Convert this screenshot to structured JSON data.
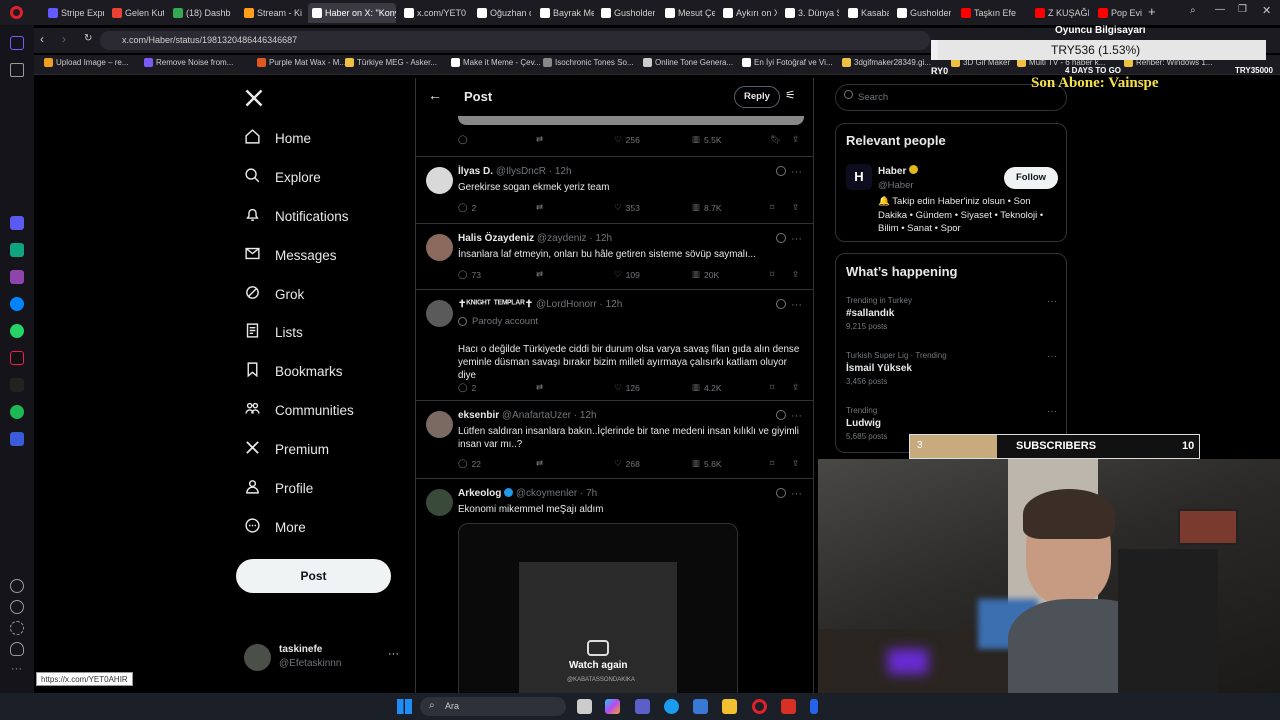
{
  "browser": {
    "tabs": [
      {
        "label": "Stripe Expre",
        "color": "#635bff"
      },
      {
        "label": "Gelen Kutu",
        "color": "#ea4335"
      },
      {
        "label": "(18) Dashb",
        "color": "#34a853"
      },
      {
        "label": "Stream - Ki",
        "color": "#ff9f1a"
      },
      {
        "label": "Haber on X: \"Konya",
        "color": "#ffffff"
      },
      {
        "label": "x.com/YET0",
        "color": "#ffffff"
      },
      {
        "label": "Oğuzhan on",
        "color": "#ffffff"
      },
      {
        "label": "Bayrak Med",
        "color": "#ffffff"
      },
      {
        "label": "Gusholder",
        "color": "#ffffff"
      },
      {
        "label": "Mesut Çevi",
        "color": "#ffffff"
      },
      {
        "label": "Aykırı on X",
        "color": "#ffffff"
      },
      {
        "label": "3. Dünya Sa",
        "color": "#ffffff"
      },
      {
        "label": "Kasabadak",
        "color": "#ffffff"
      },
      {
        "label": "Gusholder",
        "color": "#ffffff"
      },
      {
        "label": "Taşkın Efe",
        "color": "#ff0000"
      },
      {
        "label": "Z KUŞAĞI A",
        "color": "#ff0000"
      },
      {
        "label": "Pop Evil fea",
        "color": "#ff0000"
      }
    ],
    "url": "x.com/Haber/status/1981320486446346687",
    "bookmarks": [
      {
        "label": "Upload Image – re...",
        "color": "#f0a020"
      },
      {
        "label": "Remove Noise from...",
        "color": "#7a5af8"
      },
      {
        "label": "Purple Mat Wax - M...",
        "color": "#e05a20"
      },
      {
        "label": "Türkiye MEG - Asker...",
        "color": "#f0c040"
      },
      {
        "label": "Make it Meme - Çev...",
        "color": "#ffffff"
      },
      {
        "label": "Isochronic Tones So...",
        "color": "#888888"
      },
      {
        "label": "Online Tone Genera...",
        "color": "#cccccc"
      },
      {
        "label": "En İyi Fotoğraf ve Vi...",
        "color": "#ffffff"
      },
      {
        "label": "3dgifmaker28349.gi...",
        "color": "#f0c040"
      },
      {
        "label": "3D Gif Maker",
        "color": "#f0c040"
      },
      {
        "label": "Multi TV - 6 haber k...",
        "color": "#f0c040"
      },
      {
        "label": "Rehber: Windows 1...",
        "color": "#f0c040"
      }
    ],
    "status_link": "https://x.com/YET0AHIR"
  },
  "nav": {
    "items": [
      "Home",
      "Explore",
      "Notifications",
      "Messages",
      "Grok",
      "Lists",
      "Bookmarks",
      "Communities",
      "Premium",
      "Profile",
      "More"
    ],
    "post_button": "Post",
    "account": {
      "name": "taskinefe",
      "handle": "@Efetaskinnn"
    }
  },
  "header": {
    "title": "Post",
    "reply_button": "Reply"
  },
  "first_actions": {
    "likes": "256",
    "views": "5.5K"
  },
  "tweets": [
    {
      "name": "İlyas D.",
      "handle": "@IlysDncR · 12h",
      "text": "Gerekirse sogan ekmek yeriz team",
      "replies": "2",
      "likes": "353",
      "views": "8.7K"
    },
    {
      "name": "Halis Özaydeniz",
      "handle": "@zaydeniz · 12h",
      "text": "İnsanlara laf etmeyin, onları bu hâle getiren sisteme sövüp saymalı...",
      "replies": "73",
      "likes": "109",
      "views": "20K"
    },
    {
      "name": "✝ᴷᴺᴵᴳᴴᵀ ᵀᴱᴹᴾᴸᴬᴿ✝",
      "handle": "@LordHonorr · 12h",
      "parody": "Parody account",
      "text": "Hacı o değilde Türkiyede ciddi bir durum olsa varya savaş filan gıda alın dense yeminle düsman savaşı bırakır bizim milleti ayırmaya çalısırkı katliam oluyor diye",
      "replies": "2",
      "likes": "126",
      "views": "4.2K"
    },
    {
      "name": "eksenbir",
      "handle": "@AnafartaUzer · 12h",
      "text": "Lütfen saldıran insanlara bakın..İçlerinde bir tane medeni insan kılıklı ve giyimli insan var mı..?",
      "replies": "22",
      "likes": "268",
      "views": "5.6K"
    },
    {
      "name": "Arkeolog",
      "handle": "@ckoymenler · 7h",
      "text": "Ekonomi  mikemmel meŞajı aldım",
      "watch": "Watch again",
      "watermark": "@KABATASSONDAKIKA"
    }
  ],
  "right": {
    "search_placeholder": "Search",
    "relevant_title": "Relevant people",
    "person": {
      "name": "Haber",
      "handle": "@Haber",
      "bio": "🔔 Takip edin Haber'iniz olsun • Son Dakika • Gündem • Siyaset • Teknoloji • Bilim • Sanat • Spor",
      "follow": "Follow"
    },
    "happening_title": "What’s happening",
    "trends": [
      {
        "ctx": "Trending in Turkey",
        "title": "#sallandık",
        "count": "9,215 posts"
      },
      {
        "ctx": "Turkish Super Lig · Trending",
        "title": "İsmail Yüksek",
        "count": "3,456 posts"
      },
      {
        "ctx": "Trending",
        "title": "Ludwig",
        "count": "5,685 posts"
      }
    ]
  },
  "stream_overlay": {
    "top_label": "Oyuncu Bilgisayarı",
    "goal": "TRY536 (1.53%)",
    "goal_left": "RY0",
    "days": "4 DAYS TO GO",
    "goal_right": "TRY35000",
    "last_sub": "Son Abone: Vainspe",
    "sub_current": "3",
    "sub_label": "SUBSCRIBERS",
    "sub_target": "10",
    "sub_progress": 0.3
  },
  "taskbar": {
    "search_label": "Ara"
  }
}
